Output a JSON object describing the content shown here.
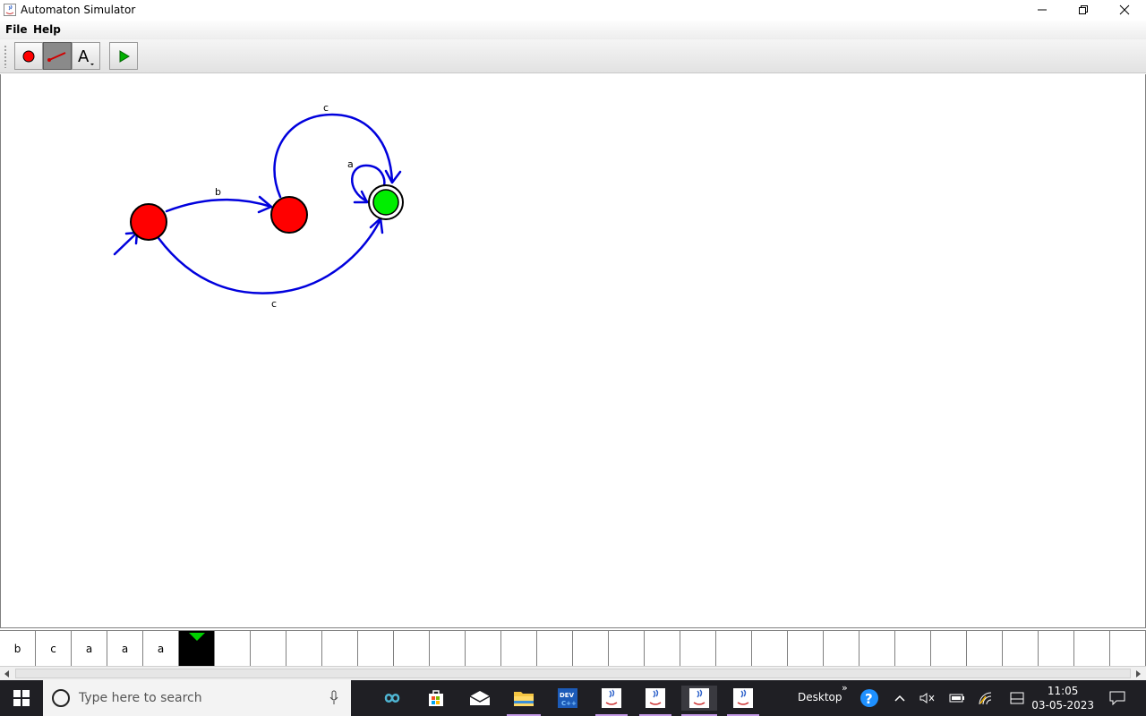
{
  "window": {
    "title": "Automaton Simulator"
  },
  "menu": {
    "items": [
      "File",
      "Help"
    ]
  },
  "toolbar": {
    "tools": [
      {
        "name": "add-state",
        "icon": "red-circle-icon"
      },
      {
        "name": "add-transition",
        "icon": "arrow-line-icon",
        "active": true
      },
      {
        "name": "add-label",
        "icon": "text-a-icon"
      },
      {
        "name": "run",
        "icon": "play-icon"
      }
    ]
  },
  "automaton": {
    "states": [
      {
        "id": "q0",
        "initial": true,
        "accepting": false,
        "color": "#ff0000"
      },
      {
        "id": "q1",
        "initial": false,
        "accepting": false,
        "color": "#ff0000"
      },
      {
        "id": "q2",
        "initial": false,
        "accepting": true,
        "color": "#00ee00"
      }
    ],
    "transitions": [
      {
        "from": "q0",
        "to": "q1",
        "symbol": "b"
      },
      {
        "from": "q1",
        "to": "q2",
        "symbol": "c"
      },
      {
        "from": "q2",
        "to": "q2",
        "symbol": "a"
      },
      {
        "from": "q0",
        "to": "q2",
        "symbol": "c"
      }
    ],
    "edge_color": "#0000dd"
  },
  "tape": {
    "cells": [
      "b",
      "c",
      "a",
      "a",
      "a",
      "",
      "",
      "",
      "",
      "",
      "",
      "",
      "",
      "",
      "",
      "",
      "",
      "",
      "",
      "",
      "",
      "",
      "",
      "",
      "",
      "",
      "",
      "",
      "",
      "",
      "",
      "",
      ""
    ],
    "head_index": 5
  },
  "taskbar": {
    "search_placeholder": "Type here to search",
    "desktop_label": "Desktop",
    "time": "11:05",
    "date": "03-05-2023"
  }
}
